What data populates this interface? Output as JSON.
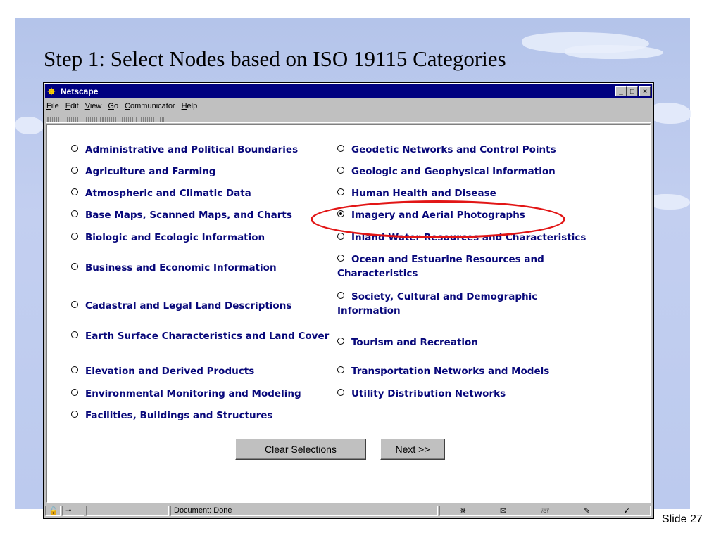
{
  "slide": {
    "title": "Step 1: Select Nodes based on ISO 19115 Categories",
    "number": "Slide 27"
  },
  "window": {
    "title": "Netscape",
    "controls": {
      "minimize": "_",
      "maximize": "□",
      "close": "×"
    },
    "menu": [
      "File",
      "Edit",
      "View",
      "Go",
      "Communicator",
      "Help"
    ]
  },
  "categories": {
    "left": [
      {
        "label": "Administrative and Political Boundaries",
        "checked": false
      },
      {
        "label": "Agriculture and Farming",
        "checked": false
      },
      {
        "label": "Atmospheric and Climatic Data",
        "checked": false
      },
      {
        "label": "Base Maps, Scanned Maps, and Charts",
        "checked": false
      },
      {
        "label": "Biologic and Ecologic Information",
        "checked": false
      },
      {
        "label": "Business and Economic Information",
        "checked": false
      },
      {
        "label": "Cadastral and Legal Land Descriptions",
        "checked": false
      },
      {
        "label": "Earth Surface Characteristics and Land Cover",
        "checked": false
      },
      {
        "label": "Elevation and Derived Products",
        "checked": false
      },
      {
        "label": "Environmental Monitoring and Modeling",
        "checked": false
      },
      {
        "label": "Facilities, Buildings and Structures",
        "checked": false
      }
    ],
    "right": [
      {
        "label": "Geodetic Networks and Control Points",
        "checked": false
      },
      {
        "label": "Geologic and Geophysical Information",
        "checked": false
      },
      {
        "label": "Human Health and Disease",
        "checked": false
      },
      {
        "label": "Imagery and Aerial Photographs",
        "checked": true
      },
      {
        "label": "Inland Water Resources and Characteristics",
        "checked": false
      },
      {
        "label": "Ocean and Estuarine Resources and Characteristics",
        "checked": false
      },
      {
        "label": "Society, Cultural and Demographic Information",
        "checked": false
      },
      {
        "label": "Tourism and Recreation",
        "checked": false
      },
      {
        "label": "Transportation Networks and Models",
        "checked": false
      },
      {
        "label": "Utility Distribution Networks",
        "checked": false
      }
    ]
  },
  "buttons": {
    "clear": "Clear Selections",
    "next": "Next >>"
  },
  "status": {
    "text": "Document: Done"
  },
  "colors": {
    "highlight": "#e21616",
    "link_text": "#08087a",
    "titlebar": "#000080"
  }
}
